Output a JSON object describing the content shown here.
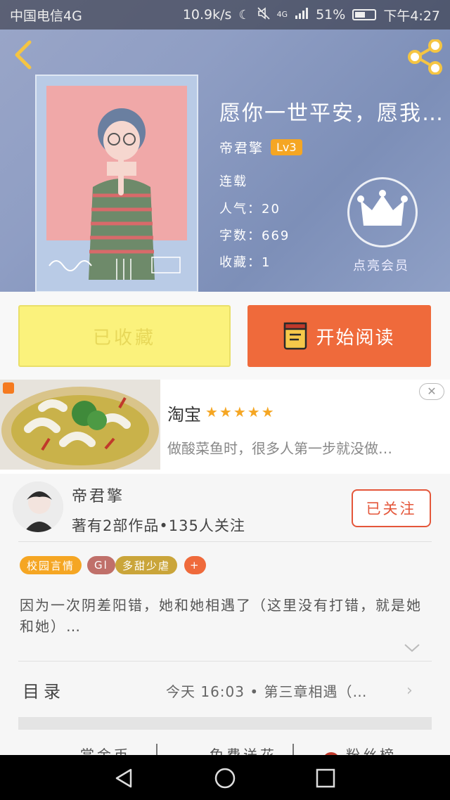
{
  "status_bar": {
    "carrier": "中国电信4G",
    "speed": "10.9k/s",
    "signal": "4G",
    "battery": "51%",
    "battery_level": 0.51,
    "time": "下午4:27"
  },
  "book": {
    "title": "愿你一世平安，愿我…",
    "author": "帝君擎",
    "level": "Lv3",
    "status": "连载",
    "popularity": "人气：20",
    "word_count": "字数：669",
    "favorites": "收藏：1",
    "vip_label": "点亮会员"
  },
  "actions": {
    "collected_label": "已收藏",
    "read_label": "开始阅读"
  },
  "ad": {
    "brand": "淘宝",
    "rating": "★★★★★",
    "description": "做酸菜鱼时，很多人第一步就没做…",
    "close": "✕"
  },
  "author_card": {
    "name": "帝君擎",
    "stats": "著有2部作品•135人关注",
    "follow_label": "已关注"
  },
  "tags": [
    {
      "label": "校园言情",
      "color": "#f5a623"
    },
    {
      "label": "Gl",
      "color": "#c0706a"
    },
    {
      "label": "多甜少虐",
      "color": "#caa53a"
    },
    {
      "label": "+",
      "color": "#ef6a3b"
    }
  ],
  "synopsis": "因为一次阴差阳错，她和她相遇了（这里没有打错，就是她和她）…",
  "toc": {
    "label": "目录",
    "latest": "今天 16:03 • 第三章相遇（…"
  },
  "bottom_actions": [
    "赏金币",
    "免费送花",
    "粉丝榜"
  ],
  "colors": {
    "accent_orange": "#ef6a3b",
    "collected_yellow": "#fbf27c",
    "follow_red": "#e4563a",
    "level_badge": "#f5a623"
  }
}
